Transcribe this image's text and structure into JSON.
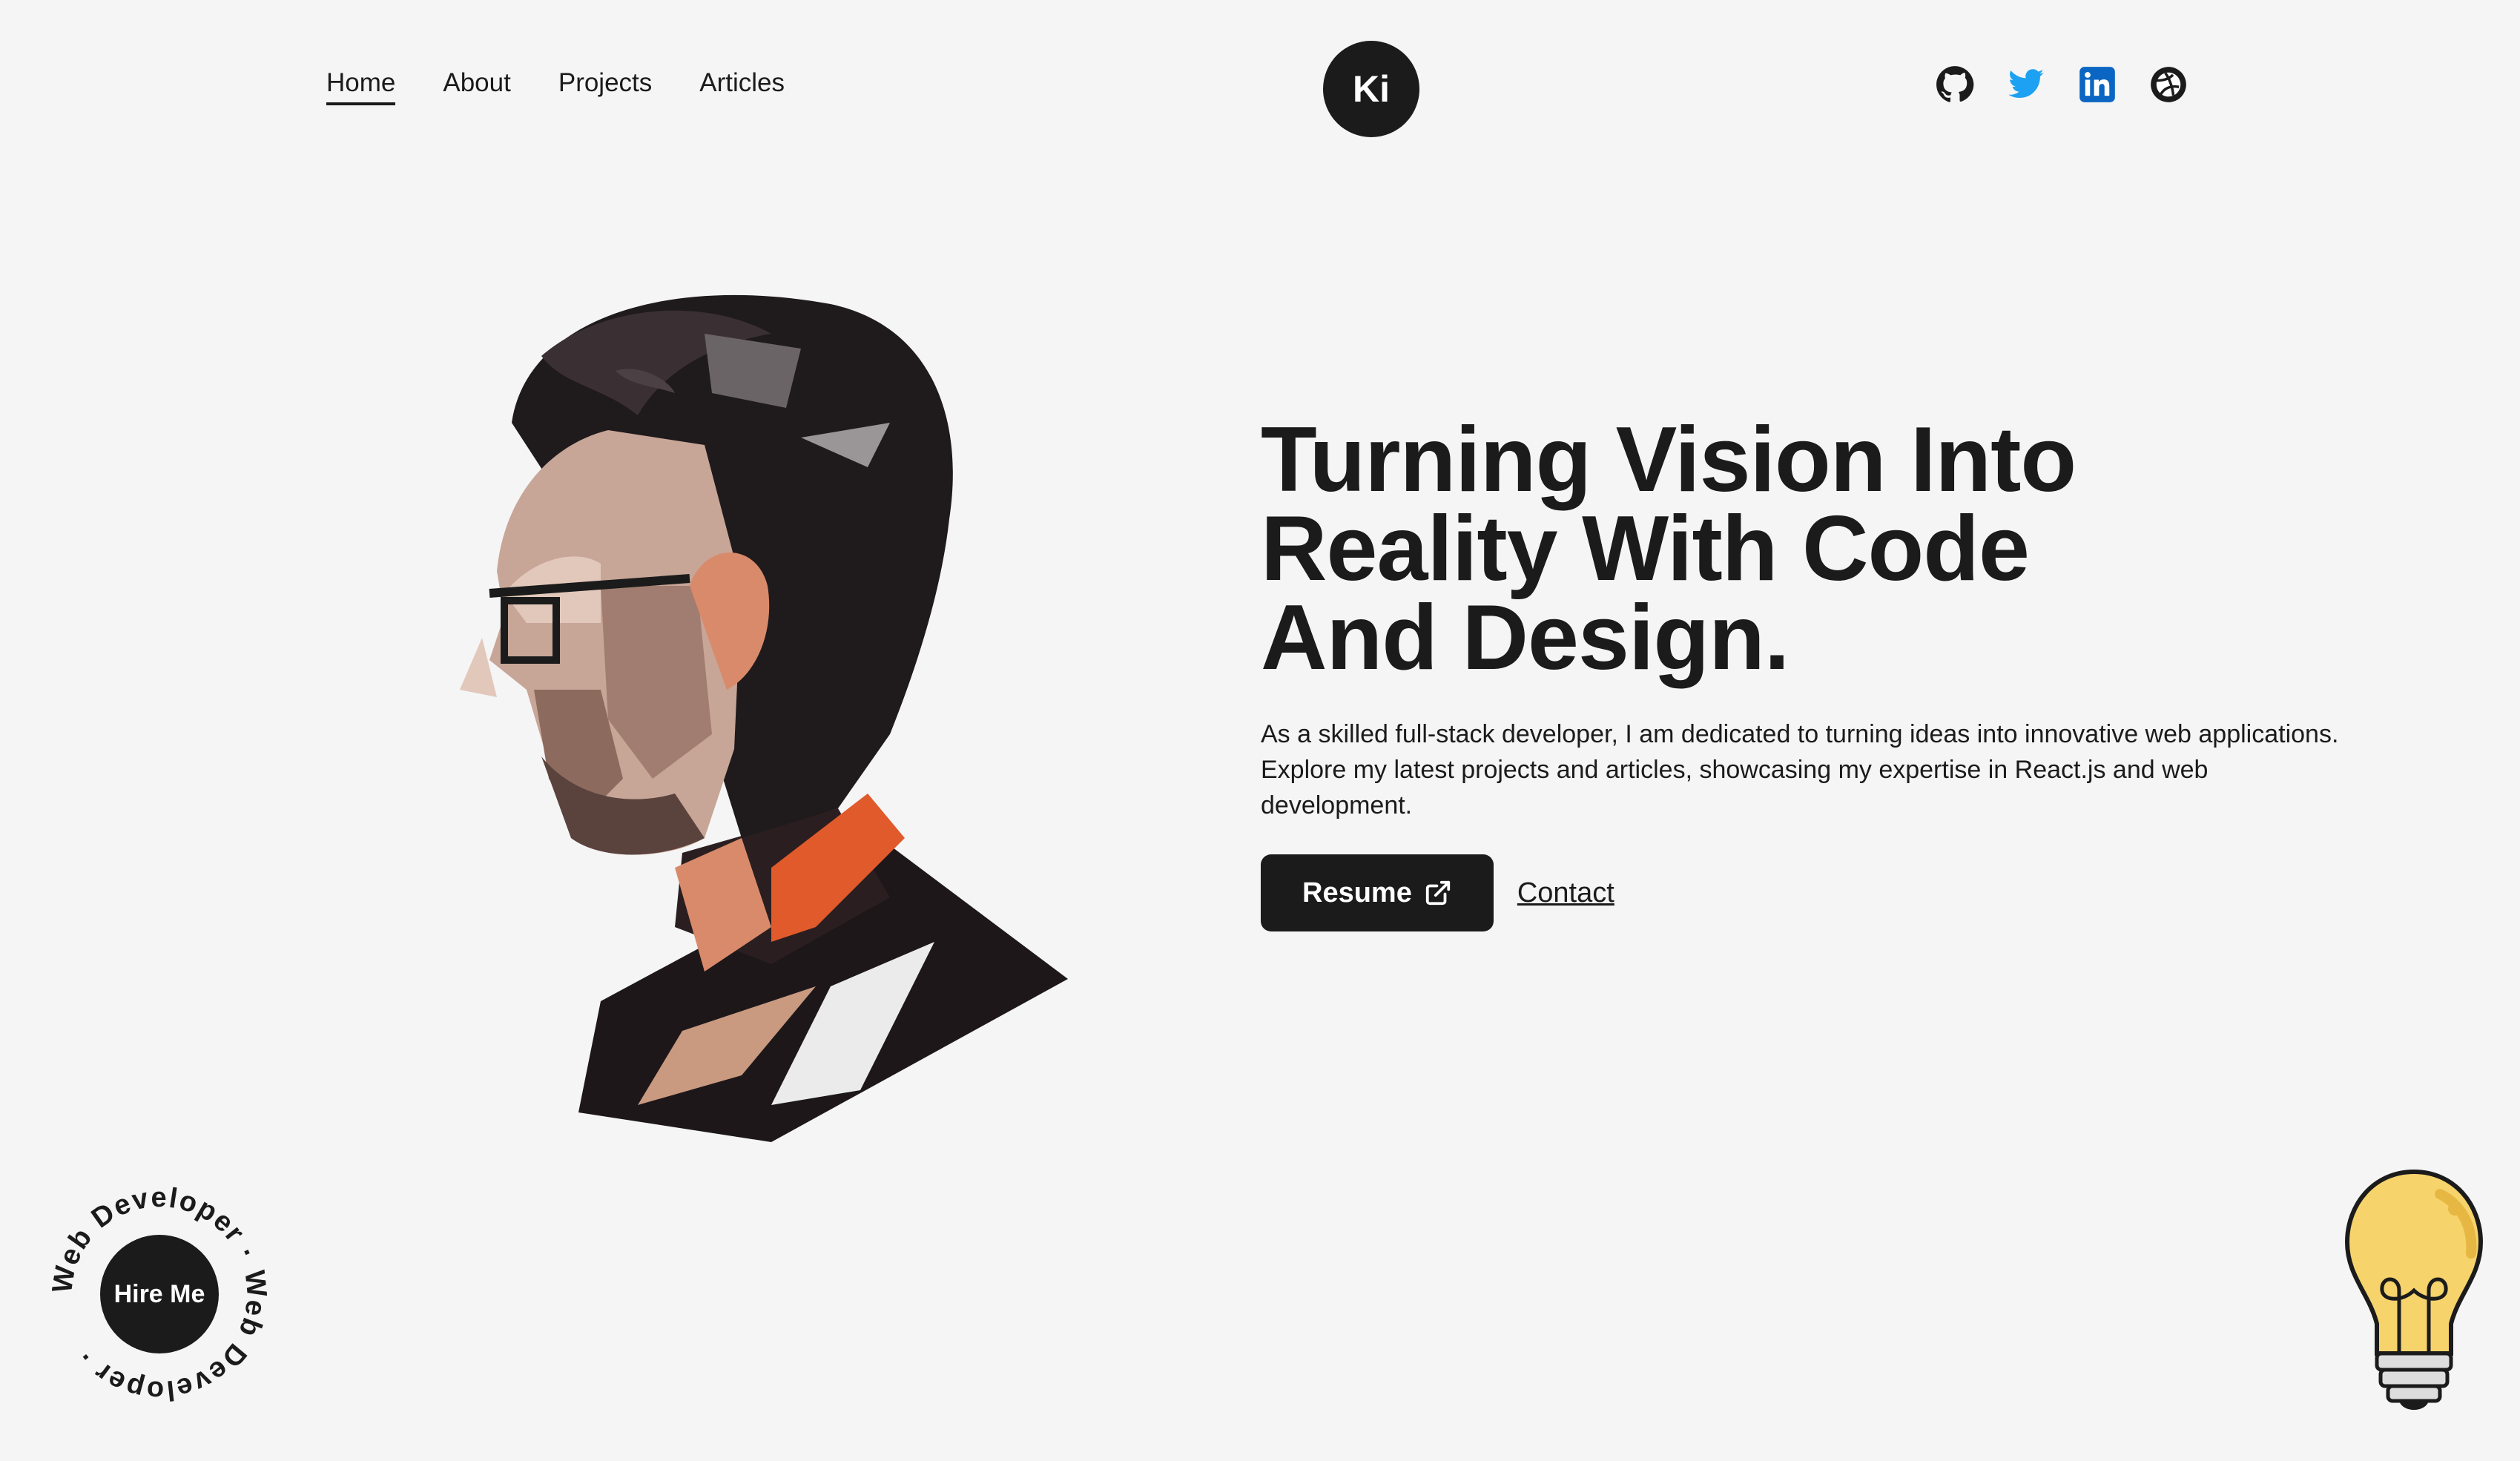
{
  "nav": {
    "links": [
      {
        "label": "Home",
        "active": true
      },
      {
        "label": "About"
      },
      {
        "label": "Projects"
      },
      {
        "label": "Articles"
      }
    ]
  },
  "logo": {
    "text": "Ki"
  },
  "socials": [
    {
      "name": "github-icon"
    },
    {
      "name": "twitter-icon",
      "color": "#1da1f2"
    },
    {
      "name": "linkedin-icon",
      "color": "#0a66c2"
    },
    {
      "name": "dribbble-icon"
    }
  ],
  "hero": {
    "headline_line1": "Turning Vision Into",
    "headline_line2": "Reality With Code",
    "headline_line3": "And Design.",
    "intro": "As a skilled full-stack developer, I am dedicated to turning ideas into innovative web applications. Explore my latest projects and articles, showcasing my expertise in React.js and web development.",
    "resume_label": "Resume",
    "contact_label": "Contact"
  },
  "hire": {
    "button_label": "Hire Me",
    "ring_text": "Web Developer · Web Developer · "
  },
  "colors": {
    "background": "#f5f5f5",
    "dark": "#1b1b1b",
    "accent": "#e05a2b",
    "bulb": "#f6d36b"
  }
}
